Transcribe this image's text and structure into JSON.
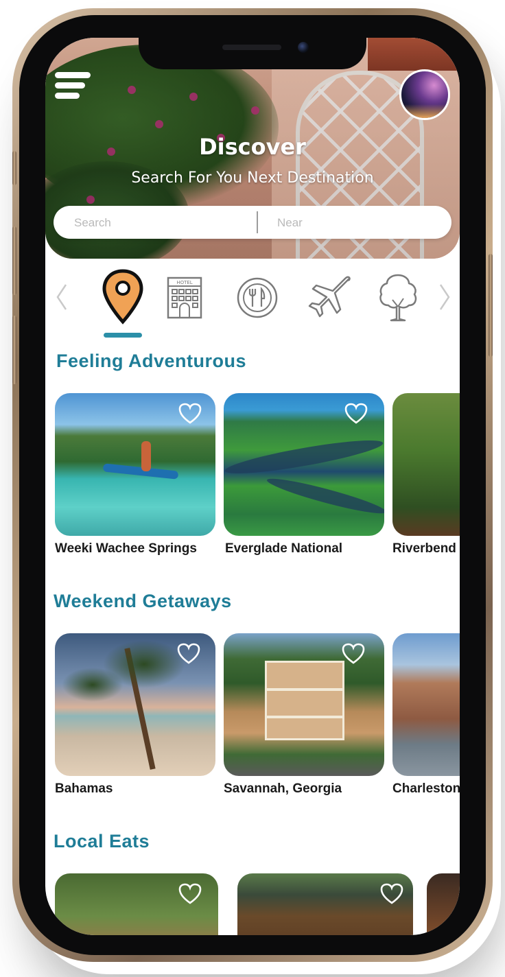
{
  "hero": {
    "title": "Discover",
    "subtitle": "Search For  You Next Destination",
    "search_placeholder": "Search",
    "near_placeholder": "Near"
  },
  "categories": [
    {
      "name": "location",
      "icon": "map-pin-icon",
      "active": true
    },
    {
      "name": "hotel",
      "icon": "hotel-icon",
      "sign": "HOTEL",
      "active": false
    },
    {
      "name": "food",
      "icon": "plate-fork-knife-icon",
      "active": false
    },
    {
      "name": "flights",
      "icon": "airplane-icon",
      "active": false
    },
    {
      "name": "nature",
      "icon": "tree-icon",
      "active": false
    }
  ],
  "sections": [
    {
      "title": "Feeling Adventurous",
      "items": [
        {
          "label": "Weeki Wachee Springs"
        },
        {
          "label": "Everglade National"
        },
        {
          "label": "Riverbend"
        }
      ]
    },
    {
      "title": "Weekend Getaways",
      "items": [
        {
          "label": "Bahamas"
        },
        {
          "label": "Savannah, Georgia"
        },
        {
          "label": "Charleston"
        }
      ]
    },
    {
      "title": "Local Eats",
      "items": [
        {
          "label": ""
        },
        {
          "label": ""
        },
        {
          "label": ""
        }
      ]
    }
  ],
  "colors": {
    "accent": "#2b8fa8",
    "title_teal": "#1f7d97",
    "pin_orange": "#f0a255",
    "phone_frame_gold": "#b89a7a"
  }
}
